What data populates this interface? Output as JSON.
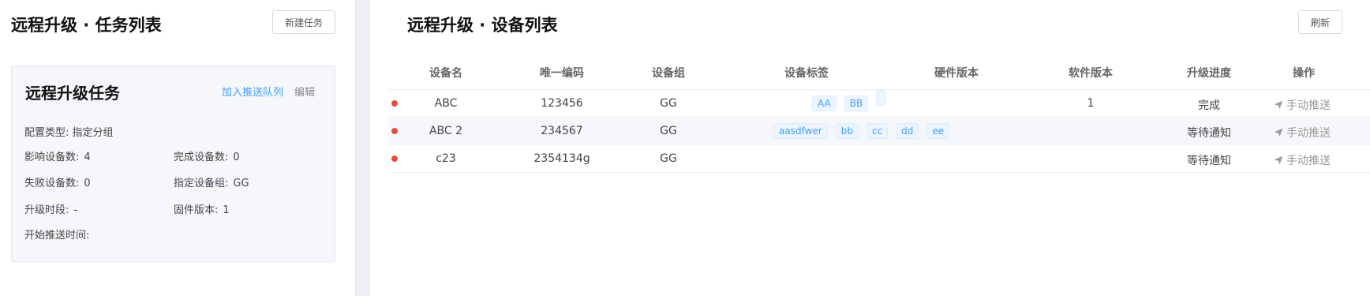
{
  "left": {
    "title": "远程升级 · 任务列表",
    "new_task_button": "新建任务",
    "card": {
      "title": "远程升级任务",
      "push_link": "加入推送队列",
      "edit_link": "编辑",
      "config_type": "配置类型: 指定分组",
      "affected_label": "影响设备数:",
      "affected_value": "4",
      "completed_label": "完成设备数:",
      "completed_value": "0",
      "failed_label": "失败设备数:",
      "failed_value": "0",
      "group_label": "指定设备组:",
      "group_value": "GG",
      "period_label": "升级时段:",
      "period_value": "-",
      "firmware_label": "固件版本:",
      "firmware_value": "1",
      "start_time_label": "开始推送时间:"
    }
  },
  "right": {
    "title": "远程升级 · 设备列表",
    "refresh_button": "刷新",
    "headers": {
      "name": "设备名",
      "code": "唯一编码",
      "group": "设备组",
      "tags": "设备标签",
      "hardware": "硬件版本",
      "software": "软件版本",
      "progress": "升级进度",
      "action": "操作"
    },
    "rows": [
      {
        "name": "ABC",
        "code": "123456",
        "group": "GG",
        "tags": [
          "AA",
          "BB"
        ],
        "hardware": "",
        "software": "1",
        "progress": "完成",
        "action": "手动推送"
      },
      {
        "name": "ABC 2",
        "code": "234567",
        "group": "GG",
        "tags": [
          "aasdfwer",
          "bb",
          "cc",
          "dd",
          "ee"
        ],
        "hardware": "",
        "software": "",
        "progress": "等待通知",
        "action": "手动推送"
      },
      {
        "name": "c23",
        "code": "2354134g",
        "group": "GG",
        "tags": [],
        "hardware": "",
        "software": "",
        "progress": "等待通知",
        "action": "手动推送"
      }
    ],
    "status_color": "#e74c3c",
    "accent_color": "#409eff"
  }
}
